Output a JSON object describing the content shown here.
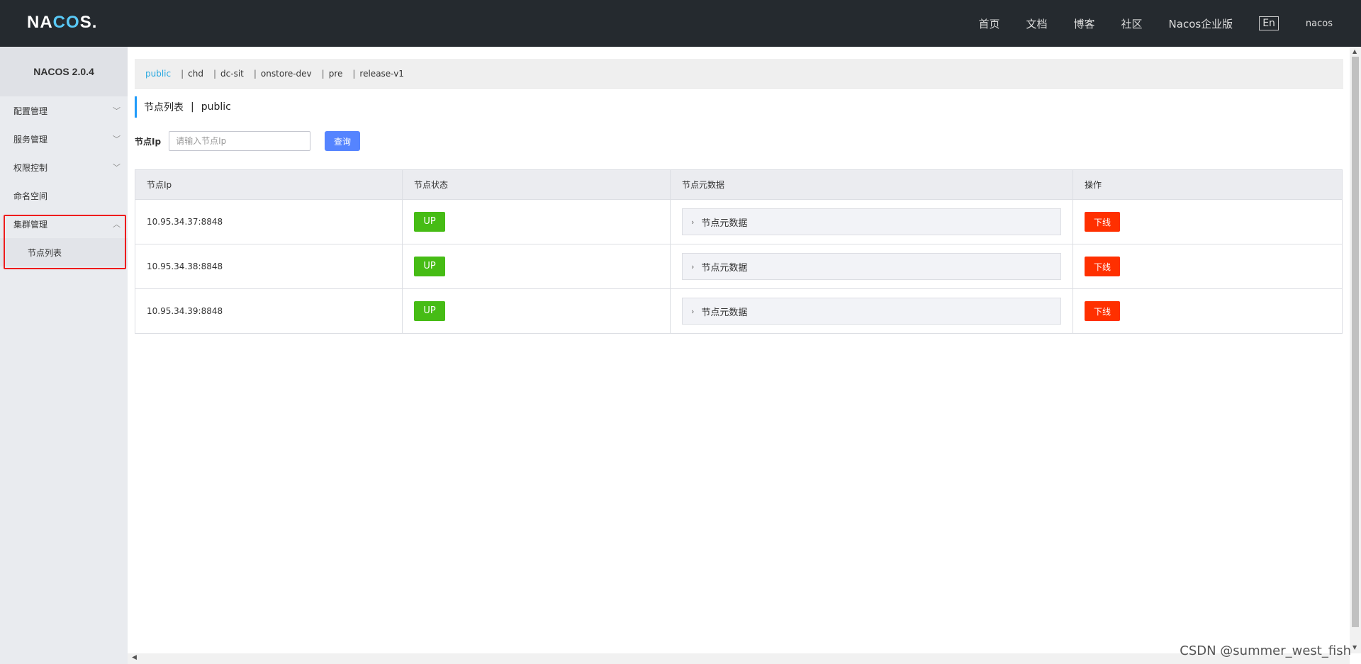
{
  "header": {
    "logo_prefix": "NA",
    "logo_o": "C",
    "logo_mid": "O",
    "logo_suffix": "S.",
    "nav": [
      "首页",
      "文档",
      "博客",
      "社区",
      "Nacos企业版"
    ],
    "lang": "En",
    "user": "nacos"
  },
  "sidebar": {
    "title": "NACOS 2.0.4",
    "items": [
      {
        "label": "配置管理",
        "chevron": "chevron-down-icon"
      },
      {
        "label": "服务管理",
        "chevron": "chevron-down-icon"
      },
      {
        "label": "权限控制",
        "chevron": "chevron-down-icon"
      },
      {
        "label": "命名空间"
      },
      {
        "label": "集群管理",
        "chevron": "chevron-up-icon"
      }
    ],
    "subitem": "节点列表",
    "highlight_color": "#ee1c1c"
  },
  "namespaces": {
    "active": "public",
    "others": [
      "chd",
      "dc-sit",
      "onstore-dev",
      "pre",
      "release-v1"
    ],
    "sep": "|"
  },
  "page": {
    "title": "节点列表",
    "sep": "|",
    "namespace": "public"
  },
  "search": {
    "label": "节点Ip",
    "placeholder": "请输入节点Ip",
    "button": "查询"
  },
  "table": {
    "headers": [
      "节点Ip",
      "节点状态",
      "节点元数据",
      "操作"
    ],
    "rows": [
      {
        "ip": "10.95.34.37:8848",
        "state": "UP",
        "meta": "节点元数据",
        "action": "下线"
      },
      {
        "ip": "10.95.34.38:8848",
        "state": "UP",
        "meta": "节点元数据",
        "action": "下线"
      },
      {
        "ip": "10.95.34.39:8848",
        "state": "UP",
        "meta": "节点元数据",
        "action": "下线"
      }
    ]
  },
  "colors": {
    "topbar": "#252a2f",
    "up_badge": "#46bc15",
    "offline_button": "#ff3000",
    "query_button": "#5584ff",
    "active_ns": "#2aa9e0"
  },
  "watermark": "CSDN @summer_west_fish"
}
